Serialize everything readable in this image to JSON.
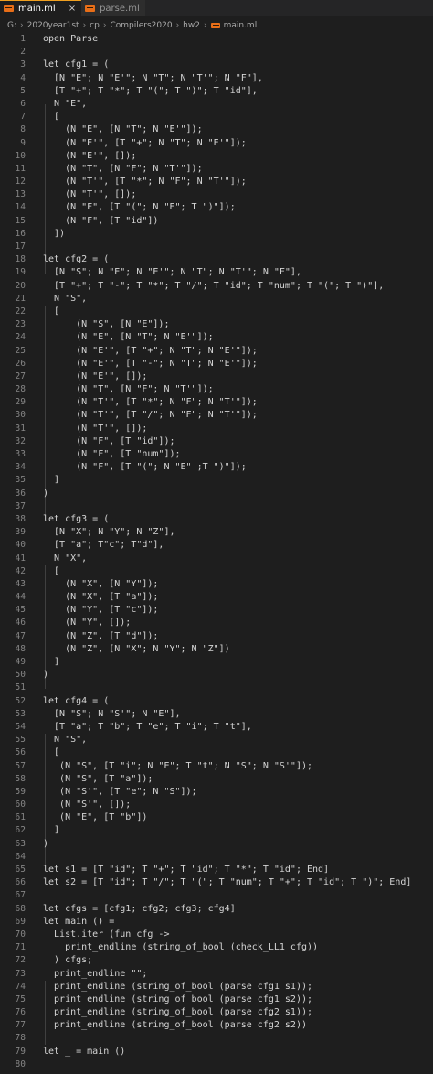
{
  "tabs": [
    {
      "label": "main.ml",
      "active": true,
      "close": "×"
    },
    {
      "label": "parse.ml",
      "active": false
    }
  ],
  "breadcrumb": [
    "G:",
    "2020year1st",
    "cp",
    "Compilers2020",
    "hw2",
    "main.ml"
  ],
  "breadcrumb_separator": "›",
  "lines": [
    "open Parse",
    "",
    "let cfg1 = (",
    "  [N \"E\"; N \"E'\"; N \"T\"; N \"T'\"; N \"F\"],",
    "  [T \"+\"; T \"*\"; T \"(\"; T \")\"; T \"id\"],",
    "  N \"E\",",
    "  [",
    "    (N \"E\", [N \"T\"; N \"E'\"]);",
    "    (N \"E'\", [T \"+\"; N \"T\"; N \"E'\"]);",
    "    (N \"E'\", []);",
    "    (N \"T\", [N \"F\"; N \"T'\"]);",
    "    (N \"T'\", [T \"*\"; N \"F\"; N \"T'\"]);",
    "    (N \"T'\", []);",
    "    (N \"F\", [T \"(\"; N \"E\"; T \")\"]);",
    "    (N \"F\", [T \"id\"])",
    "  ])",
    "",
    "let cfg2 = (",
    "  [N \"S\"; N \"E\"; N \"E'\"; N \"T\"; N \"T'\"; N \"F\"],",
    "  [T \"+\"; T \"-\"; T \"*\"; T \"/\"; T \"id\"; T \"num\"; T \"(\"; T \")\"],",
    "  N \"S\",",
    "  [",
    "      (N \"S\", [N \"E\"]);",
    "      (N \"E\", [N \"T\"; N \"E'\"]);",
    "      (N \"E'\", [T \"+\"; N \"T\"; N \"E'\"]);",
    "      (N \"E'\", [T \"-\"; N \"T\"; N \"E'\"]);",
    "      (N \"E'\", []);",
    "      (N \"T\", [N \"F\"; N \"T'\"]);",
    "      (N \"T'\", [T \"*\"; N \"F\"; N \"T'\"]);",
    "      (N \"T'\", [T \"/\"; N \"F\"; N \"T'\"]);",
    "      (N \"T'\", []);",
    "      (N \"F\", [T \"id\"]);",
    "      (N \"F\", [T \"num\"]);",
    "      (N \"F\", [T \"(\"; N \"E\" ;T \")\"]);",
    "  ]",
    ")",
    "",
    "let cfg3 = (",
    "  [N \"X\"; N \"Y\"; N \"Z\"],",
    "  [T \"a\"; T\"c\"; T\"d\"],",
    "  N \"X\",",
    "  [",
    "    (N \"X\", [N \"Y\"]);",
    "    (N \"X\", [T \"a\"]);",
    "    (N \"Y\", [T \"c\"]);",
    "    (N \"Y\", []);",
    "    (N \"Z\", [T \"d\"]);",
    "    (N \"Z\", [N \"X\"; N \"Y\"; N \"Z\"])",
    "  ]",
    ")",
    "",
    "let cfg4 = (",
    "  [N \"S\"; N \"S'\"; N \"E\"],",
    "  [T \"a\"; T \"b\"; T \"e\"; T \"i\"; T \"t\"],",
    "  N \"S\",",
    "  [",
    "   (N \"S\", [T \"i\"; N \"E\"; T \"t\"; N \"S\"; N \"S'\"]);",
    "   (N \"S\", [T \"a\"]);",
    "   (N \"S'\", [T \"e\"; N \"S\"]);",
    "   (N \"S'\", []);",
    "   (N \"E\", [T \"b\"])",
    "  ]",
    ")",
    "",
    "let s1 = [T \"id\"; T \"+\"; T \"id\"; T \"*\"; T \"id\"; End]",
    "let s2 = [T \"id\"; T \"/\"; T \"(\"; T \"num\"; T \"+\"; T \"id\"; T \")\"; End]",
    "",
    "let cfgs = [cfg1; cfg2; cfg3; cfg4]",
    "let main () =",
    "  List.iter (fun cfg ->",
    "    print_endline (string_of_bool (check_LL1 cfg))",
    "  ) cfgs;",
    "  print_endline \"\";",
    "  print_endline (string_of_bool (parse cfg1 s1));",
    "  print_endline (string_of_bool (parse cfg1 s2));",
    "  print_endline (string_of_bool (parse cfg2 s1));",
    "  print_endline (string_of_bool (parse cfg2 s2))",
    "",
    "let _ = main ()",
    ""
  ],
  "line_numbers": [
    "1",
    "2",
    "3",
    "4",
    "5",
    "6",
    "7",
    "8",
    "9",
    "10",
    "11",
    "12",
    "13",
    "14",
    "15",
    "16",
    "17",
    "18",
    "19",
    "20",
    "21",
    "22",
    "23",
    "24",
    "25",
    "26",
    "27",
    "28",
    "29",
    "30",
    "31",
    "32",
    "33",
    "34",
    "35",
    "36",
    "37",
    "38",
    "39",
    "40",
    "41",
    "42",
    "43",
    "44",
    "45",
    "46",
    "47",
    "48",
    "49",
    "50",
    "51",
    "52",
    "53",
    "54",
    "55",
    "56",
    "57",
    "58",
    "59",
    "60",
    "61",
    "62",
    "63",
    "64",
    "65",
    "66",
    "67",
    "68",
    "69",
    "70",
    "71",
    "72",
    "73",
    "74",
    "75",
    "76",
    "77",
    "78",
    "79",
    "80"
  ],
  "colors": {
    "editor_bg": "#1e1e1e",
    "tab_bar_bg": "#252526",
    "text": "#d4d4d4",
    "line_number": "#858585",
    "ocaml_icon": "#e86e18"
  }
}
